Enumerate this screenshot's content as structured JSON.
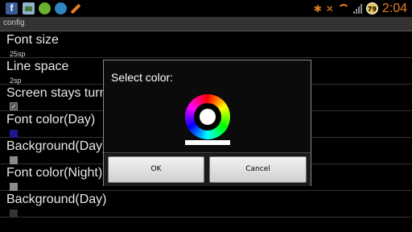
{
  "status_bar": {
    "facebook_glyph": "f",
    "battery_level": "79",
    "time": "2:04",
    "accent_color": "#e67e22"
  },
  "title_bar": {
    "title": "config"
  },
  "settings": [
    {
      "label": "Font size",
      "value": "25sp",
      "kind": "text"
    },
    {
      "label": "Line space",
      "value": "2sp",
      "kind": "text"
    },
    {
      "label": "Screen stays turn on",
      "checked": true,
      "kind": "checkbox"
    },
    {
      "label": "Font color(Day)",
      "swatch_color": "#1a1a8c",
      "kind": "swatch"
    },
    {
      "label": "Background(Day)",
      "swatch_color": "#8a8a8a",
      "kind": "swatch"
    },
    {
      "label": "Font color(Night)",
      "swatch_color": "#8a8a8a",
      "kind": "swatch"
    },
    {
      "label": "Background(Day)",
      "swatch_color": "#333333",
      "kind": "swatch"
    }
  ],
  "dialog": {
    "title": "Select color:",
    "selected_color": "#ffffff",
    "ok_label": "OK",
    "cancel_label": "Cancel"
  }
}
